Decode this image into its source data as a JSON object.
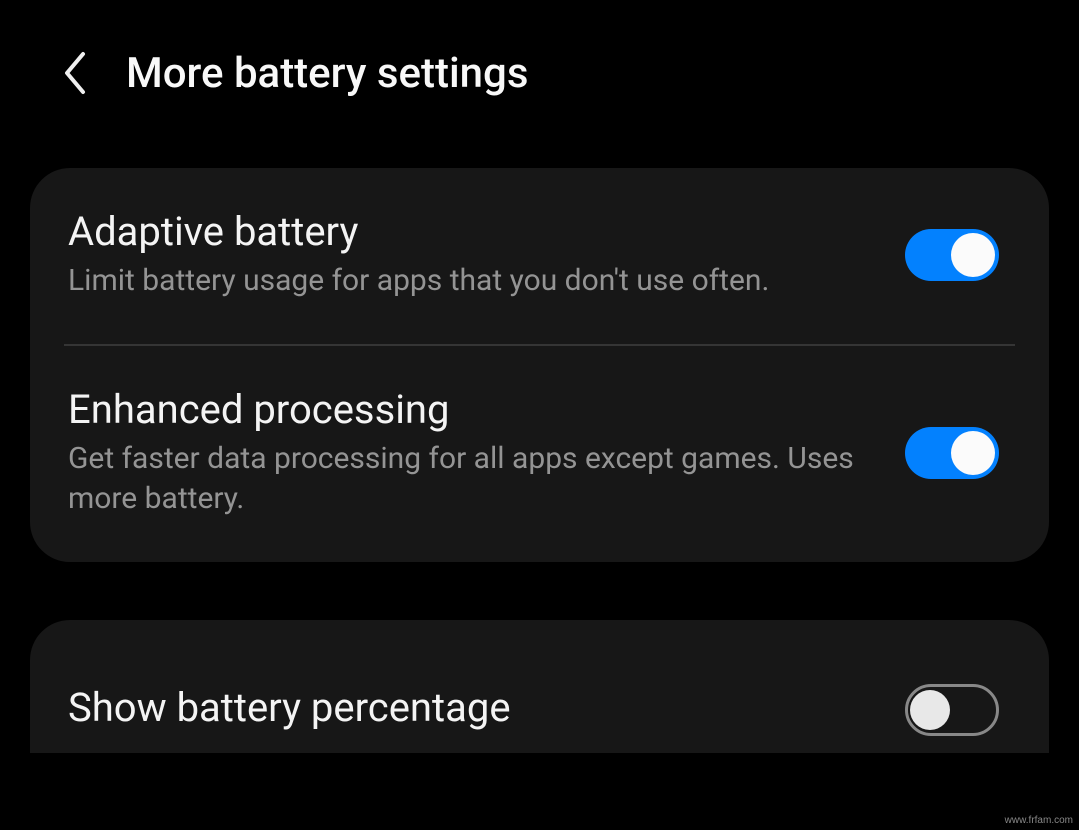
{
  "header": {
    "title": "More battery settings"
  },
  "settings": {
    "adaptive": {
      "title": "Adaptive battery",
      "description": "Limit battery usage for apps that you don't use often.",
      "enabled": true
    },
    "enhanced": {
      "title": "Enhanced processing",
      "description": "Get faster data processing for all apps except games. Uses more battery.",
      "enabled": true
    },
    "percentage": {
      "title": "Show battery percentage",
      "enabled": false
    }
  },
  "watermark": "www.frfam.com"
}
